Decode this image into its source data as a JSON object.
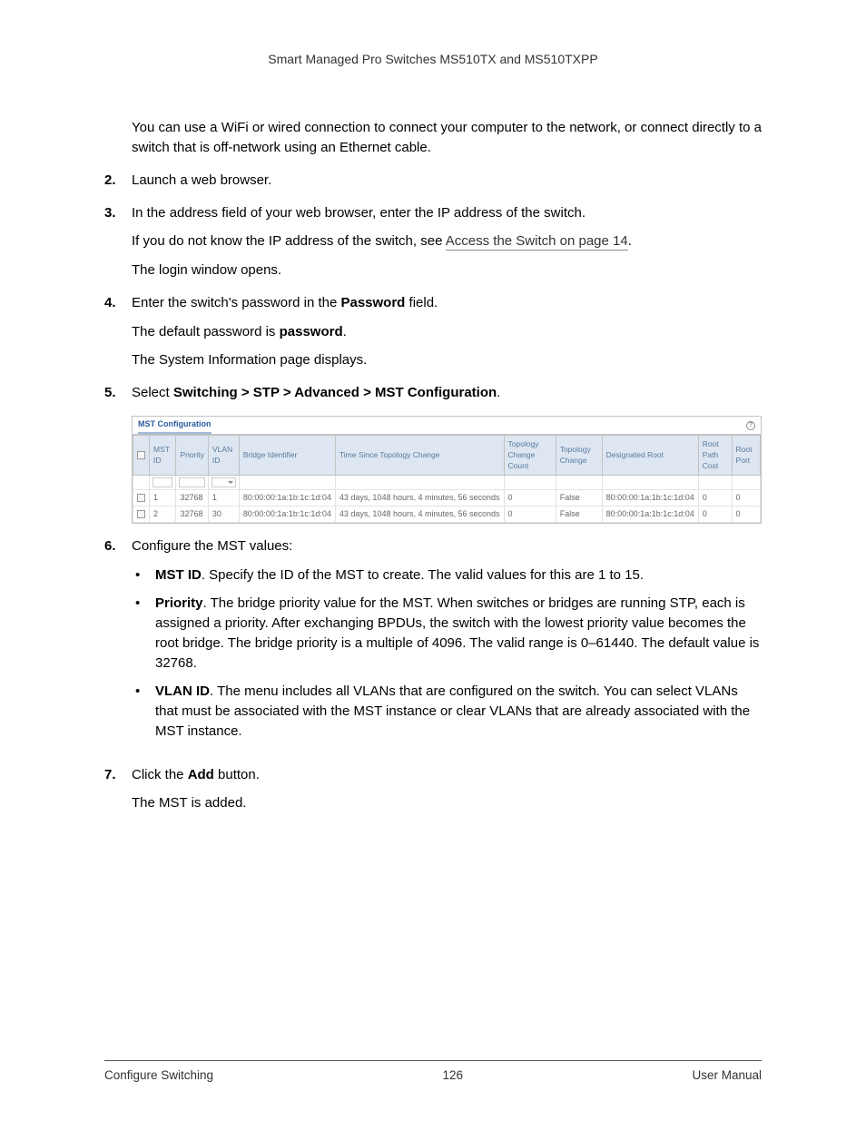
{
  "doc_header": "Smart Managed Pro Switches MS510TX and MS510TXPP",
  "intro_para": "You can use a WiFi or wired connection to connect your computer to the network, or connect directly to a switch that is off-network using an Ethernet cable.",
  "step2_num": "2.",
  "step2_text": "Launch a web browser.",
  "step3_num": "3.",
  "step3_text": "In the address field of your web browser, enter the IP address of the switch.",
  "step3_note_a": "If you do not know the IP address of the switch, see ",
  "step3_link": "Access the Switch on page 14",
  "step3_note_b": ".",
  "step3_after": "The login window opens.",
  "step4_num": "4.",
  "step4_a": "Enter the switch's password in the ",
  "step4_bold": "Password",
  "step4_b": " field.",
  "step4_note1_a": "The default password is ",
  "step4_note1_bold": "password",
  "step4_note1_b": ".",
  "step4_note2": "The System Information page displays.",
  "step5_num": "5.",
  "step5_a": "Select ",
  "step5_bold": "Switching > STP > Advanced > MST Configuration",
  "step5_b": ".",
  "mst_title": "MST Configuration",
  "help_q": "?",
  "cols": {
    "mstid": "MST ID",
    "priority": "Priority",
    "vlan": "VLAN ID",
    "bridge": "Bridge Identifier",
    "tstc": "Time Since Topology Change",
    "tcc": "Topology Change Count",
    "tc": "Topology Change",
    "droot": "Designated Root",
    "rpc": "Root Path Cost",
    "rport": "Root Port"
  },
  "rows": [
    {
      "mstid": "1",
      "priority": "32768",
      "vlan": "1",
      "bridge": "80:00:00:1a:1b:1c:1d:04",
      "tstc": "43 days, 1048 hours, 4 minutes, 56 seconds",
      "tcc": "0",
      "tc": "False",
      "droot": "80:00:00:1a:1b:1c:1d:04",
      "rpc": "0",
      "rport": "0"
    },
    {
      "mstid": "2",
      "priority": "32768",
      "vlan": "30",
      "bridge": "80:00:00:1a:1b:1c:1d:04",
      "tstc": "43 days, 1048 hours, 4 minutes, 56 seconds",
      "tcc": "0",
      "tc": "False",
      "droot": "80:00:00:1a:1b:1c:1d:04",
      "rpc": "0",
      "rport": "0"
    }
  ],
  "step6_num": "6.",
  "step6_text": "Configure the MST values:",
  "b1_label": "MST ID",
  "b1_text": ". Specify the ID of the MST to create. The valid values for this are 1 to 15.",
  "b2_label": "Priority",
  "b2_text": ". The bridge priority value for the MST. When switches or bridges are running STP, each is assigned a priority. After exchanging BPDUs, the switch with the lowest priority value becomes the root bridge. The bridge priority is a multiple of 4096. The valid range is 0–61440. The default value is 32768.",
  "b3_label": "VLAN ID",
  "b3_text": ". The menu includes all VLANs that are configured on the switch. You can select VLANs that must be associated with the MST instance or clear VLANs that are already associated with the MST instance.",
  "step7_num": "7.",
  "step7_a": "Click the ",
  "step7_bold": "Add",
  "step7_b": " button.",
  "step7_after": "The MST is added.",
  "footer_left": "Configure Switching",
  "footer_center": "126",
  "footer_right": "User Manual",
  "bullet_glyph": "•"
}
